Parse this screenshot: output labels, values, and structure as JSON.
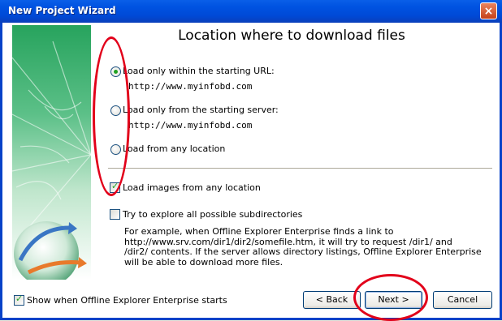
{
  "window": {
    "title": "New Project Wizard",
    "close_glyph": "×"
  },
  "page": {
    "title": "Location where to download files"
  },
  "options": {
    "radio1": {
      "label": "Load only within the starting URL:",
      "url": "http://www.myinfobd.com",
      "checked": true
    },
    "radio2": {
      "label": "Load only from the starting server:",
      "url": "http://www.myinfobd.com",
      "checked": false
    },
    "radio3": {
      "label": "Load from any location",
      "checked": false
    }
  },
  "checkboxes": {
    "load_images": {
      "label": "Load images from any location",
      "checked": true
    },
    "explore_subdirs": {
      "label": "Try to explore all possible subdirectories",
      "checked": false
    },
    "show_on_start": {
      "label": "Show when Offline Explorer Enterprise starts",
      "checked": true
    }
  },
  "note_lines": [
    "For example, when Offline Explorer Enterprise finds a link to",
    "http://www.srv.com/dir1/dir2/somefile.htm, it will try to request /dir1/ and",
    "/dir2/ contents. If the server allows directory listings, Offline Explorer Enterprise",
    "will be able to download more files."
  ],
  "buttons": {
    "back": "< Back",
    "next": "Next >",
    "cancel": "Cancel"
  },
  "colors": {
    "titlebar": "#0053e1",
    "annotation": "#e2001a",
    "banner_green": "#27a35d"
  },
  "icons": {
    "close": "close-icon",
    "banner": "globe-arrows-banner-icon"
  }
}
